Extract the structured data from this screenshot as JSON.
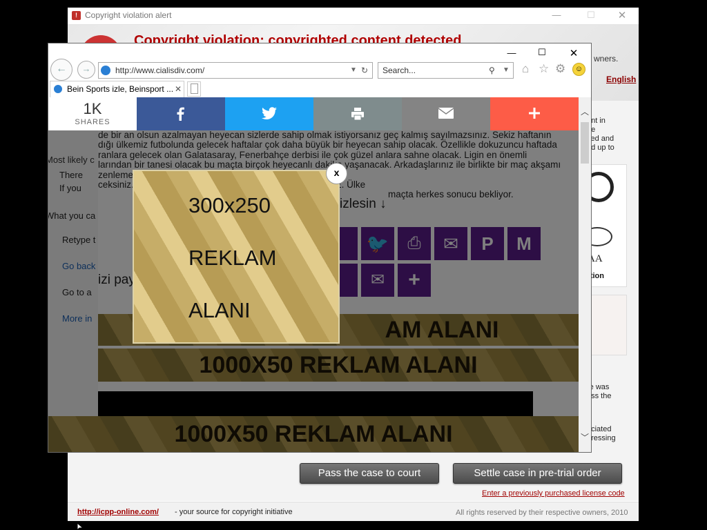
{
  "alert_window": {
    "title": "Copyright violation alert",
    "heading": "Copyright violation: copyrighted content detected",
    "owners_fragment": "wners.",
    "language_link": "English",
    "right_fragments": [
      "ent in",
      "he",
      "ited and",
      "nd up to"
    ],
    "right_fragments_2": [
      "re was",
      "ass the"
    ],
    "right_fragments_3": [
      "ociated",
      "pressing"
    ],
    "seal_caption": "AA",
    "seal_label": "dation",
    "buttons": {
      "pass": "Pass the case to court",
      "settle": "Settle case in pre-trial order"
    },
    "license_link": "Enter a previously purchased license code",
    "footer": {
      "link": "http://icpp-online.com/",
      "middle": " - your source for copyright initiative",
      "right": "All rights reserved by their respective owners, 2010"
    }
  },
  "browser": {
    "url": "http://www.cialisdiv.com/",
    "search_placeholder": "Search...",
    "tab_title": "Bein Sports izle, Beinsport ...",
    "share_count": "1K",
    "share_label": "SHARES",
    "colors": {
      "facebook": "#3b5998",
      "twitter": "#1da1f2",
      "print": "#7f8c8d",
      "email": "#848484",
      "more": "#fd5c47",
      "social_square": "#5a1d8a"
    }
  },
  "page": {
    "article_lines": [
      "de bir an olsun azalmayan heyecan sizlerde sahip olmak istiyorsanız geç kalmış sayılmazsınız. Sekiz haftanın",
      "dığı ülkemiz futbolunda gelecek haftalar çok daha büyük bir heyecan sahip olacak. Özellikle dokuzuncu haftada",
      "ranlara gelecek olan Galatasaray, Fenerbahçe derbisi ile çok güzel anlara sahne olacak. Ligin en önemli",
      "larından bir tanesi olacak bu maçta birçok heyecanlı dakika yaşanacak. Arkadaşlarınız ile birlikte bir maç akşamı",
      "zenleme... de mücadelenin doksan dakikasına kesintisiz",
      "ceksiniz. ... ne olacak karşılaşmayı kaçırmamış olacaksınız. Ülke",
      "maçta herkes sonucu bekliyor."
    ],
    "watch_heading": "izlesin ↓",
    "left_fragment": "izi pay",
    "error_fragments": {
      "likely": "Most likely c",
      "there": "There",
      "ifyou": "If you",
      "whatyou": "What you ca",
      "retype": "Retype t",
      "goback": "Go back",
      "goto": "Go to  a",
      "moreinfo": "More in"
    },
    "banners": [
      "1000X50 REKLAM ALANI",
      "1000X50 REKLAM ALANI",
      "1000X50 REKLAM ALANI"
    ],
    "banner_top_fragment": "AM ALANI"
  },
  "ad_popup": {
    "close": "x",
    "line1": "300x250",
    "line2": "REKLAM",
    "line3": "ALANI"
  }
}
